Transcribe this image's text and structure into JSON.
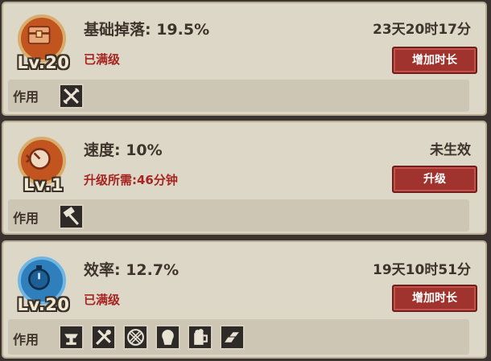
{
  "buffs": [
    {
      "name": "基础掉落: 19.5%",
      "level": "Lv.20",
      "status": "已满级",
      "time": "23天20时17分",
      "button": "增加时长",
      "effect_label": "作用",
      "icons": [
        "crossed-swords-icon"
      ]
    },
    {
      "name": "速度: 10%",
      "level": "Lv.1",
      "status": "升级所需:46分钟",
      "time": "未生效",
      "button": "升级",
      "effect_label": "作用",
      "icons": [
        "hammer-icon"
      ]
    },
    {
      "name": "效率: 12.7%",
      "level": "Lv.20",
      "status": "已满级",
      "time": "19天10时51分",
      "button": "增加时长",
      "effect_label": "作用",
      "icons": [
        "anvil-icon",
        "tools-icon",
        "net-icon",
        "cupcake-icon",
        "beer-mug-icon",
        "ingot-icon"
      ]
    }
  ]
}
